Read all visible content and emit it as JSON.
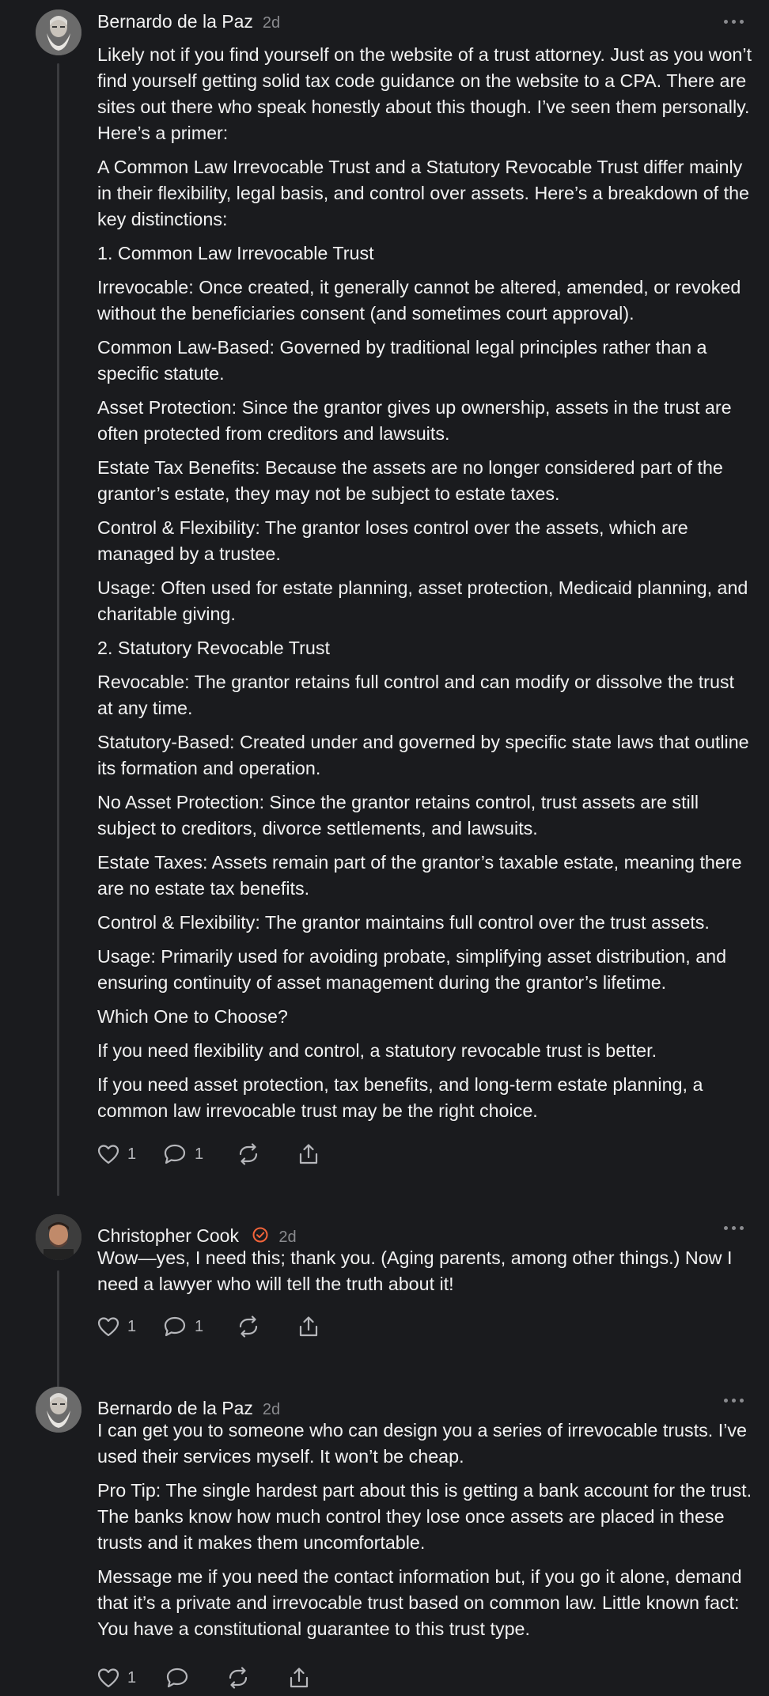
{
  "posts": [
    {
      "author": "Bernardo de la Paz",
      "time": "2d",
      "paragraphs": [
        "Likely not if you find yourself on the website of a trust attorney. Just as you won’t find yourself getting solid tax code guidance on the website to a CPA. There are sites out there who speak honestly about this though. I’ve seen them personally. Here’s a primer:",
        "A Common Law Irrevocable Trust and a Statutory Revocable Trust differ mainly in their flexibility, legal basis, and control over assets. Here’s a breakdown of the key distinctions:",
        "1. Common Law Irrevocable Trust",
        "Irrevocable: Once created, it generally cannot be altered, amended, or revoked without the beneficiaries consent (and sometimes court approval).",
        "Common Law-Based: Governed by traditional legal principles rather than a specific statute.",
        "Asset Protection: Since the grantor gives up ownership, assets in the trust are often protected from creditors and lawsuits.",
        "Estate Tax Benefits: Because the assets are no longer considered part of the grantor’s estate, they may not be subject to estate taxes.",
        "Control & Flexibility: The grantor loses control over the assets, which are managed by a trustee.",
        "Usage: Often used for estate planning, asset protection, Medicaid planning, and charitable giving.",
        "2. Statutory Revocable Trust",
        "Revocable: The grantor retains full control and can modify or dissolve the trust at any time.",
        "Statutory-Based: Created under and governed by specific state laws that outline its formation and operation.",
        "No Asset Protection: Since the grantor retains control, trust assets are still subject to creditors, divorce settlements, and lawsuits.",
        "Estate Taxes: Assets remain part of the grantor’s taxable estate, meaning there are no estate tax benefits.",
        "Control & Flexibility: The grantor maintains full control over the trust assets.",
        "Usage: Primarily used for avoiding probate, simplifying asset distribution, and ensuring continuity of asset management during the grantor’s lifetime.",
        "Which One to Choose?",
        "If you need flexibility and control, a statutory revocable trust is better.",
        "If you need asset protection, tax benefits, and long-term estate planning, a common law irrevocable trust may be the right choice."
      ],
      "likes": "1",
      "replies": "1"
    },
    {
      "author": "Christopher Cook",
      "time": "2d",
      "paragraphs": [
        "Wow—yes, I need this; thank you. (Aging parents, among other things.) Now I need a lawyer who will tell the truth about it!"
      ],
      "likes": "1",
      "replies": "1"
    },
    {
      "author": "Bernardo de la Paz",
      "time": "2d",
      "paragraphs": [
        "I can get you to someone who can design you a series of irrevocable trusts. I’ve used their services myself. It won’t be cheap.",
        "Pro Tip: The single hardest part about this is getting a bank account for the trust. The banks know how much control they lose once assets are placed in these trusts and it makes them uncomfortable.",
        "Message me if you need the contact information but, if you go it alone, demand that it’s a private and irrevocable trust based on common law. Little known fact: You have a constitutional guarantee to this trust type."
      ],
      "likes": "1",
      "replies": ""
    }
  ],
  "icons": {
    "like": "heart-icon",
    "reply": "comment-icon",
    "repost": "repost-icon",
    "share": "share-icon",
    "more": "more-icon",
    "verified": "verified-badge-icon"
  },
  "colors": {
    "background": "#1a1b1e",
    "text": "#f2f2f2",
    "muted": "#8a8b8f",
    "verified": "#f3643a"
  }
}
